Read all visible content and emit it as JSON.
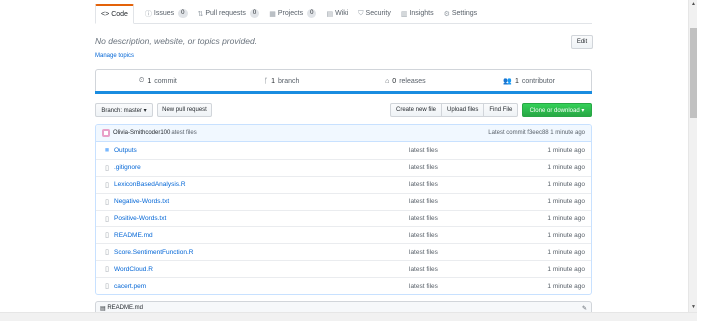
{
  "tabs": [
    {
      "icon": "<>",
      "label": "Code",
      "count": ""
    },
    {
      "icon": "ⓘ",
      "label": "Issues",
      "count": "0"
    },
    {
      "icon": "⇅",
      "label": "Pull requests",
      "count": "0"
    },
    {
      "icon": "▦",
      "label": "Projects",
      "count": "0"
    },
    {
      "icon": "▤",
      "label": "Wiki",
      "count": ""
    },
    {
      "icon": "⛉",
      "label": "Security",
      "count": ""
    },
    {
      "icon": "▥",
      "label": "Insights",
      "count": ""
    },
    {
      "icon": "⚙",
      "label": "Settings",
      "count": ""
    }
  ],
  "repo": {
    "description": "No description, website, or topics provided.",
    "manage_topics": "Manage topics",
    "edit_label": "Edit"
  },
  "summary": {
    "commits": {
      "icon": "⏲",
      "count": "1",
      "label": "commit"
    },
    "branches": {
      "icon": "ᚴ",
      "count": "1",
      "label": "branch"
    },
    "releases": {
      "icon": "⌂",
      "count": "0",
      "label": "releases"
    },
    "contributors": {
      "icon": "👥",
      "count": "1",
      "label": "contributor"
    }
  },
  "toolbar": {
    "branch_label": "Branch: master ▾",
    "new_pr_label": "New pull request",
    "create_file_label": "Create new file",
    "upload_files_label": "Upload files",
    "find_file_label": "Find File",
    "clone_label": "Clone or download ▾"
  },
  "commit": {
    "author": "Olivia-Smithcoder100",
    "message": "atest files",
    "latest": "Latest commit f3eec88 1 minute ago"
  },
  "files": [
    {
      "type": "dir",
      "name": "Outputs",
      "message": "latest files",
      "age": "1 minute ago"
    },
    {
      "type": "file",
      "name": ".gitignore",
      "message": "latest files",
      "age": "1 minute ago"
    },
    {
      "type": "file",
      "name": "LexiconBasedAnalysis.R",
      "message": "latest files",
      "age": "1 minute ago"
    },
    {
      "type": "file",
      "name": "Negative-Words.txt",
      "message": "latest files",
      "age": "1 minute ago"
    },
    {
      "type": "file",
      "name": "Positive-Words.txt",
      "message": "latest files",
      "age": "1 minute ago"
    },
    {
      "type": "file",
      "name": "README.md",
      "message": "latest files",
      "age": "1 minute ago"
    },
    {
      "type": "file",
      "name": "Score.SentimentFunction.R",
      "message": "latest files",
      "age": "1 minute ago"
    },
    {
      "type": "file",
      "name": "WordCloud.R",
      "message": "latest files",
      "age": "1 minute ago"
    },
    {
      "type": "file",
      "name": "cacert.pem",
      "message": "latest files",
      "age": "1 minute ago"
    }
  ],
  "readme": {
    "label": "README.md",
    "edit_icon": "✎"
  },
  "colors": {
    "accent": "#e36209",
    "link": "#0366d6",
    "green": "#28a745",
    "langbar": "#198ce0"
  }
}
